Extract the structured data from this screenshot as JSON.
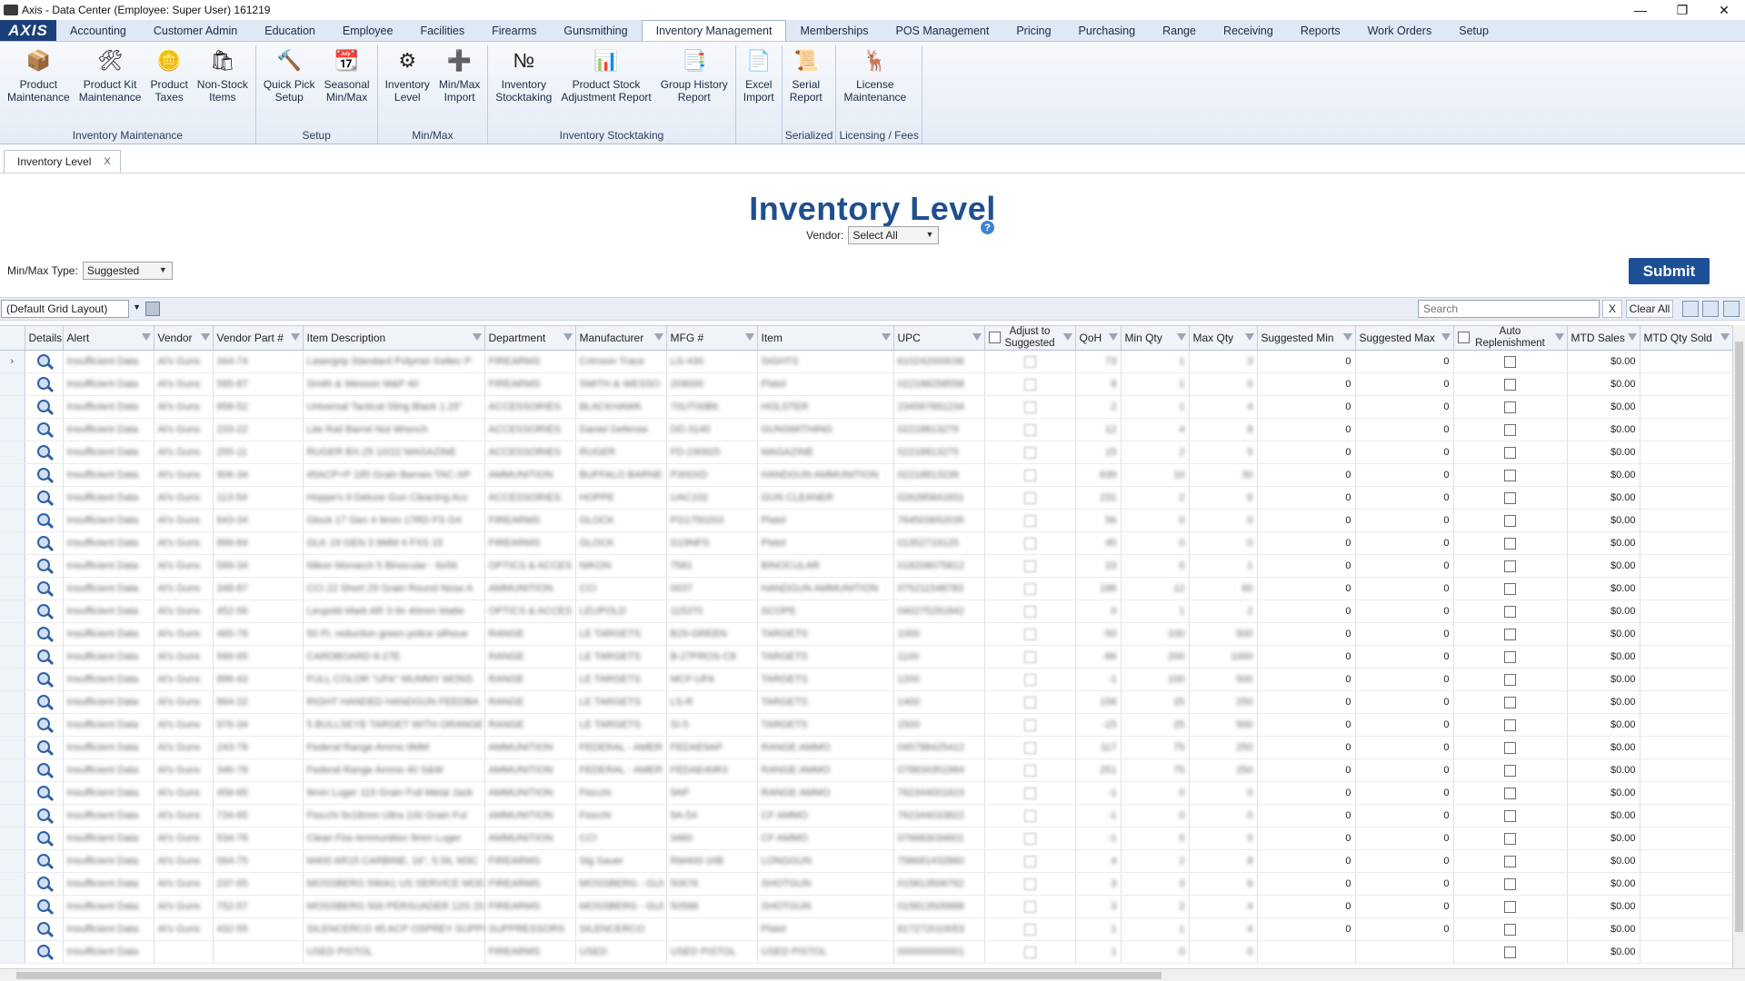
{
  "window": {
    "title": "Axis - Data Center  (Employee: Super User) 161219"
  },
  "menu": {
    "logo": "AXIS",
    "items": [
      "Accounting",
      "Customer Admin",
      "Education",
      "Employee",
      "Facilities",
      "Firearms",
      "Gunsmithing",
      "Inventory Management",
      "Memberships",
      "POS Management",
      "Pricing",
      "Purchasing",
      "Range",
      "Receiving",
      "Reports",
      "Work Orders",
      "Setup"
    ],
    "active": "Inventory Management"
  },
  "ribbon": {
    "groups": [
      {
        "label": "Inventory Maintenance",
        "buttons": [
          "Product\nMaintenance",
          "Product Kit\nMaintenance",
          "Product\nTaxes",
          "Non-Stock\nItems"
        ]
      },
      {
        "label": "Setup",
        "buttons": [
          "Quick Pick\nSetup",
          "Seasonal\nMin/Max"
        ]
      },
      {
        "label": "Min/Max",
        "buttons": [
          "Inventory\nLevel",
          "Min/Max\nImport"
        ]
      },
      {
        "label": "Inventory Stocktaking",
        "buttons": [
          "Inventory\nStocktaking",
          "Product Stock\nAdjustment Report",
          "Group History\nReport"
        ]
      },
      {
        "label": "",
        "buttons": [
          "Excel\nImport"
        ]
      },
      {
        "label": "Serialized",
        "buttons": [
          "Serial\nReport"
        ]
      },
      {
        "label": "Licensing / Fees",
        "buttons": [
          "License\nMaintenance"
        ]
      }
    ]
  },
  "doc_tab": {
    "label": "Inventory Level",
    "close": "X"
  },
  "page": {
    "title": "Inventory Level",
    "help": "?"
  },
  "filters": {
    "vendor_label": "Vendor:",
    "vendor_value": "Select All",
    "minmax_label": "Min/Max Type:",
    "minmax_value": "Suggested",
    "submit": "Submit"
  },
  "toolbar": {
    "layout": "(Default Grid Layout)",
    "search_placeholder": "Search",
    "clear_x": "X",
    "clear_all": "Clear All"
  },
  "grid": {
    "columns": [
      "Details",
      "Alert",
      "Vendor",
      "Vendor Part #",
      "Item Description",
      "Department",
      "Manufacturer",
      "MFG #",
      "Item",
      "UPC",
      "Adjust to\nSuggested",
      "QoH",
      "Min Qty",
      "Max Qty",
      "Suggested Min",
      "Suggested Max",
      "Auto\nReplenishment",
      "MTD Sales",
      "MTD Qty Sold"
    ],
    "rows": [
      [
        "Insufficient Data",
        "Al's Guns",
        "344-74",
        "Lasergrip Standard Polymer Keltec P",
        "FIREARMS",
        "Crimson Trace",
        "LG-430",
        "SIGHTS",
        "610242000036",
        "73",
        "1",
        "3",
        "0",
        "0",
        "$0.00"
      ],
      [
        "Insufficient Data",
        "Al's Guns",
        "565-87",
        "Smith & Wesson M&P 40",
        "FIREARMS",
        "SMITH & WESSO",
        "209000",
        "Pistol",
        "022188258558",
        "8",
        "1",
        "0",
        "0",
        "0",
        "$0.00"
      ],
      [
        "Insufficient Data",
        "Al's Guns",
        "858-52",
        "Universal Tactical Sling Black 1.25\"",
        "ACCESSORIES",
        "BLACKHAWK",
        "70UT00BK",
        "HOLSTER",
        "234567891234",
        "2",
        "1",
        "4",
        "0",
        "0",
        "$0.00"
      ],
      [
        "Insufficient Data",
        "Al's Guns",
        "233-22",
        "Lite Rail Barrel Nut Wrench",
        "ACCESSORIES",
        "Daniel Defense",
        "DD-3140",
        "GUNSMITHING",
        "02218813279",
        "12",
        "4",
        "8",
        "0",
        "0",
        "$0.00"
      ],
      [
        "Insufficient Data",
        "Al's Guns",
        "255-11",
        "RUGER BX-25 10/22 MAGAZINE",
        "ACCESSORIES",
        "RUGER",
        "FD-230925",
        "MAGAZINE",
        "02218813275",
        "15",
        "2",
        "5",
        "0",
        "0",
        "$0.00"
      ],
      [
        "Insufficient Data",
        "Al's Guns",
        "906-34",
        "45ACP+P 185 Grain Barnes TAC-XP",
        "AMMUNITION",
        "BUFFALO BARNE",
        "P300XD",
        "HANDGUN AMMUNITION",
        "02218813239",
        "639",
        "10",
        "30",
        "0",
        "0",
        "$0.00"
      ],
      [
        "Insufficient Data",
        "Al's Guns",
        "113-54",
        "Hoppe's 9 Deluxe Gun Cleaning Acc",
        "ACCESSORIES",
        "HOPPE",
        "UAC102",
        "GUN CLEANER",
        "026285841831",
        "231",
        "2",
        "6",
        "0",
        "0",
        "$0.00"
      ],
      [
        "Insufficient Data",
        "Al's Guns",
        "643-34",
        "Glock 17 Gen 4 9mm 17RD FS G4",
        "FIREARMS",
        "GLOCK",
        "PG1750203",
        "Pistol",
        "764503652035",
        "56",
        "0",
        "0",
        "0",
        "0",
        "$0.00"
      ],
      [
        "Insufficient Data",
        "Al's Guns",
        "899-84",
        "GLK 19 GEN 3 9MM 4 FXS 15",
        "FIREARMS",
        "GLOCK",
        "G19NFS",
        "Pistol",
        "01352719125",
        "45",
        "0",
        "0",
        "0",
        "0",
        "$0.00"
      ],
      [
        "Insufficient Data",
        "Al's Guns",
        "569-34",
        "Nikon Monarch 5 Binocular - 8x56",
        "OPTICS & ACCES",
        "NIKON",
        "7581",
        "BINOCULAR",
        "018208075812",
        "23",
        "0",
        "1",
        "0",
        "0",
        "$0.00"
      ],
      [
        "Insufficient Data",
        "Al's Guns",
        "348-87",
        "CCI 22 Short 29 Grain Round Nose A",
        "AMMUNITION",
        "CCI",
        "0037",
        "HANDGUN AMMUNITION",
        "075211548783",
        "196",
        "12",
        "60",
        "0",
        "0",
        "$0.00"
      ],
      [
        "Insufficient Data",
        "Al's Guns",
        "452-56",
        "Leupold Mark AR 3-9x 40mm Matte",
        "OPTICS & ACCES",
        "LEUPOLD",
        "115370",
        "SCOPE",
        "040275291842",
        "0",
        "1",
        "2",
        "0",
        "0",
        "$0.00"
      ],
      [
        "Insufficient Data",
        "Al's Guns",
        "465-78",
        "50 Ft. reduction green police silhoue",
        "RANGE",
        "LE TARGETS",
        "B29-GREEN",
        "TARGETS",
        "1000",
        "-50",
        "100",
        "500",
        "0",
        "0",
        "$0.00"
      ],
      [
        "Insufficient Data",
        "Al's Guns",
        "566-65",
        "CARDBOARD 8-27E",
        "RANGE",
        "LE TARGETS",
        "B-27PROS-C8",
        "TARGETS",
        "1100",
        "-66",
        "200",
        "1000",
        "0",
        "0",
        "$0.00"
      ],
      [
        "Insufficient Data",
        "Al's Guns",
        "896-43",
        "FULL COLOR \"UFA\" MUMMY MONS",
        "RANGE",
        "LE TARGETS",
        "MCF-UFA",
        "TARGETS",
        "1200",
        "-1",
        "100",
        "500",
        "0",
        "0",
        "$0.00"
      ],
      [
        "Insufficient Data",
        "Al's Guns",
        "864-22",
        "RIGHT HANDED HANDGUN FEEDBA",
        "RANGE",
        "LE TARGETS",
        "LS-R",
        "TARGETS",
        "1400",
        "158",
        "25",
        "250",
        "0",
        "0",
        "$0.00"
      ],
      [
        "Insufficient Data",
        "Al's Guns",
        "976-34",
        "5 BULLSEYE TARGET WITH ORANGE",
        "RANGE",
        "LE TARGETS",
        "SI-5",
        "TARGETS",
        "1500",
        "-15",
        "25",
        "500",
        "0",
        "0",
        "$0.00"
      ],
      [
        "Insufficient Data",
        "Al's Guns",
        "243-78",
        "Federal Range Ammo 9MM",
        "AMMUNITION",
        "FEDERAL - AMER",
        "FEDAE9AP",
        "RANGE AMMO",
        "045788425412",
        "117",
        "75",
        "250",
        "0",
        "0",
        "$0.00"
      ],
      [
        "Insufficient Data",
        "Al's Guns",
        "346-78",
        "Federal Range Ammo 40 S&W",
        "AMMUNITION",
        "FEDERAL - AMER",
        "FEDAE40R3",
        "RANGE AMMO",
        "078834351984",
        "251",
        "75",
        "250",
        "0",
        "0",
        "$0.00"
      ],
      [
        "Insufficient Data",
        "Al's Guns",
        "456-65",
        "9mm Luger 115 Grain Full Metal Jack",
        "AMMUNITION",
        "Fiocchi",
        "9AP",
        "RANGE AMMO",
        "762344001623",
        "-1",
        "0",
        "0",
        "0",
        "0",
        "$0.00"
      ],
      [
        "Insufficient Data",
        "Al's Guns",
        "734-65",
        "Fiocchi 9x18mm Ultra 100 Grain Ful",
        "AMMUNITION",
        "Fiocchi",
        "9A-54",
        "CF AMMO",
        "762344033822",
        "-1",
        "0",
        "0",
        "0",
        "0",
        "$0.00"
      ],
      [
        "Insufficient Data",
        "Al's Guns",
        "534-78",
        "Clean Fire Ammunition 9mm Luger",
        "AMMUNITION",
        "CCI",
        "3460",
        "CF AMMO",
        "076683034601",
        "-1",
        "0",
        "0",
        "0",
        "0",
        "$0.00"
      ],
      [
        "Insufficient Data",
        "Al's Guns",
        "564-75",
        "M400 AR15 CARBINE, 16\", 5.56, M3C",
        "FIREARMS",
        "Sig Sauer",
        "RM400-16B",
        "LONGGUN",
        "798681432860",
        "4",
        "2",
        "8",
        "0",
        "0",
        "$0.00"
      ],
      [
        "Insufficient Data",
        "Al's Guns",
        "237-65",
        "MOSSBERG 590A1 US SERVICE MOD",
        "FIREARMS",
        "MOSSBERG - GUI",
        "50676",
        "SHOTGUN",
        "015813506762",
        "3",
        "3",
        "6",
        "0",
        "0",
        "$0.00"
      ],
      [
        "Insufficient Data",
        "Al's Guns",
        "752-57",
        "MOSSBERG 500 PERSUADER 12G 20",
        "FIREARMS",
        "MOSSBERG - GUI",
        "50588",
        "SHOTGUN",
        "015813505888",
        "3",
        "2",
        "4",
        "0",
        "0",
        "$0.00"
      ],
      [
        "Insufficient Data",
        "Al's Guns",
        "432-55",
        "SILENCERCO 45 ACP OSPREY SUPPR",
        "SUPPRESSORS",
        "SILENCERCO",
        "",
        "Pistol",
        "817272010053",
        "1",
        "1",
        "4",
        "0",
        "0",
        "$0.00"
      ],
      [
        "Insufficient Data",
        "",
        "",
        "USED PISTOL",
        "FIREARMS",
        "USED",
        "USED PISTOL",
        "USED PISTOL",
        "000000000001",
        "1",
        "0",
        "0",
        "",
        "",
        "$0.00"
      ]
    ]
  }
}
